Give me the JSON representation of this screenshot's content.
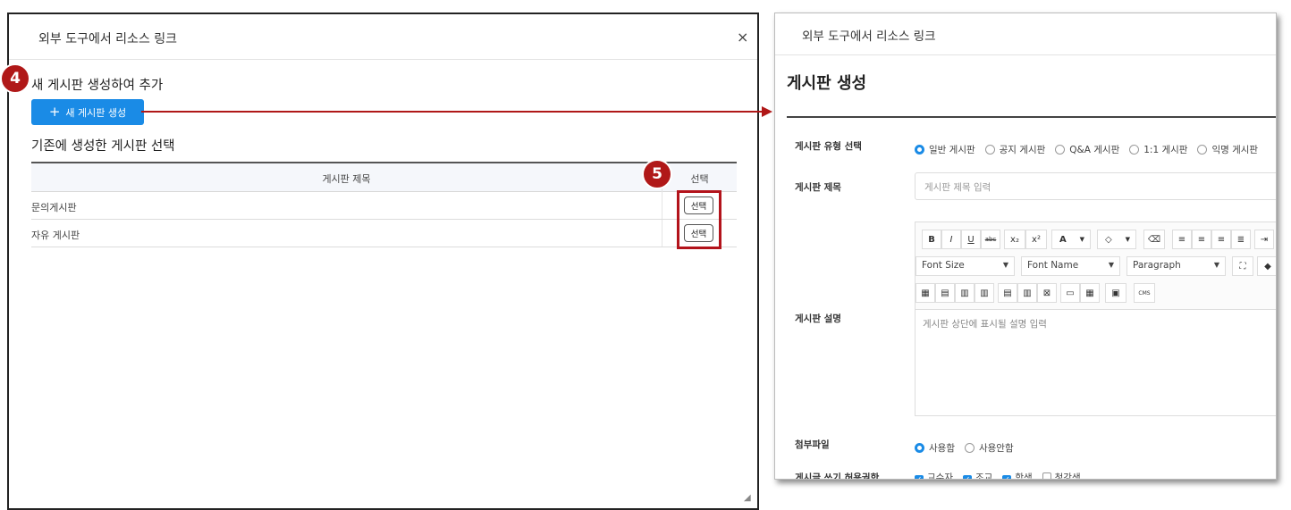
{
  "left_modal": {
    "title": "외부 도구에서 리소스 링크",
    "close": "×",
    "section_new": "새 게시판 생성하여 추가",
    "new_button": {
      "icon": "+",
      "label": "새 게시판 생성"
    },
    "section_existing": "기존에 생성한 게시판 선택",
    "table": {
      "headers": [
        "게시판 제목",
        "선택"
      ],
      "rows": [
        {
          "title": "문의게시판",
          "action": "선택"
        },
        {
          "title": "자유 게시판",
          "action": "선택"
        }
      ]
    }
  },
  "markers": {
    "step4": "4",
    "step5": "5"
  },
  "right_panel": {
    "title": "외부 도구에서 리소스 링크",
    "heading": "게시판 생성",
    "type_label": "게시판 유형 선택",
    "types": [
      {
        "label": "일반 게시판",
        "selected": true
      },
      {
        "label": "공지 게시판",
        "selected": false
      },
      {
        "label": "Q&A 게시판",
        "selected": false
      },
      {
        "label": "1:1 게시판",
        "selected": false
      },
      {
        "label": "익명 게시판",
        "selected": false
      }
    ],
    "title_label": "게시판 제목",
    "title_placeholder": "게시판 제목 입력",
    "desc_label": "게시판 설명",
    "desc_placeholder": "게시판 상단에 표시될 설명 입력",
    "toolbar": {
      "bold": "B",
      "italic": "I",
      "underline": "U",
      "strike": "abc",
      "sub": "x₂",
      "sup": "x²",
      "font_color": "A",
      "fill": "◇",
      "font_size": "Font Size",
      "font_name": "Font Name",
      "paragraph": "Paragraph"
    },
    "attach_label": "첨부파일",
    "attach_options": [
      {
        "label": "사용함",
        "selected": true
      },
      {
        "label": "사용안함",
        "selected": false
      }
    ],
    "write_perm_label": "게시글 쓰기 허용권한",
    "write_perms": [
      {
        "label": "교수자",
        "checked": true
      },
      {
        "label": "조교",
        "checked": true
      },
      {
        "label": "학생",
        "checked": true
      },
      {
        "label": "청강생",
        "checked": false
      }
    ]
  },
  "colors": {
    "accent": "#1a8be6",
    "marker": "#b01818"
  }
}
